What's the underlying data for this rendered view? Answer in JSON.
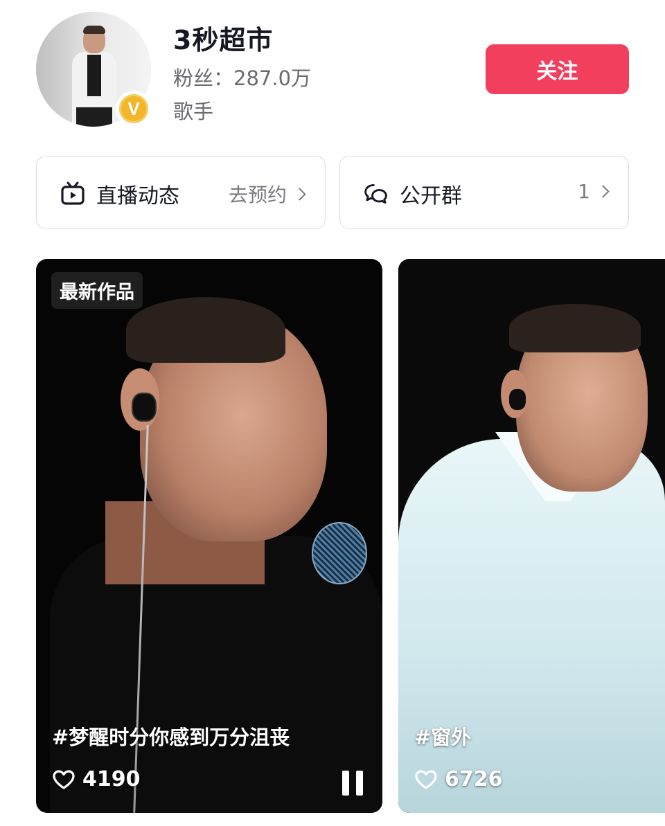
{
  "profile": {
    "name": "3秒超市",
    "fans": "粉丝：287.0万",
    "role": "歌手",
    "badge_letter": "V",
    "follow_label": "关注"
  },
  "cards": {
    "live": {
      "icon": "tv-icon",
      "title": "直播动态",
      "action": "去预约"
    },
    "group": {
      "icon": "chat-bubbles-icon",
      "title": "公开群",
      "count": "1"
    }
  },
  "videos": [
    {
      "badge": "最新作品",
      "caption": "#梦醒时分你感到万分沮丧",
      "likes": "4190"
    },
    {
      "caption": "#窗外",
      "likes": "6726"
    }
  ],
  "colors": {
    "accent": "#f23f5d",
    "badge_gold": "#f3b52a",
    "text_primary": "#161823",
    "text_secondary": "#6a6b70"
  }
}
